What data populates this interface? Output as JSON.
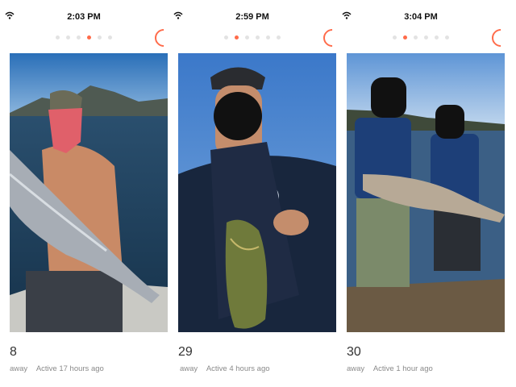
{
  "profiles": [
    {
      "time": "2:03 PM",
      "active_dot": 3,
      "dot_count": 6,
      "age": "8",
      "distance_suffix": "away",
      "activity": "Active 17 hours ago",
      "photo": "man-on-boat-holding-salmon"
    },
    {
      "time": "2:59 PM",
      "active_dot": 1,
      "dot_count": 6,
      "age": "29",
      "distance_suffix": "away",
      "activity": "Active 4 hours ago",
      "photo": "man-in-navy-tshirt-holding-bass"
    },
    {
      "time": "3:04 PM",
      "active_dot": 1,
      "dot_count": 6,
      "age": "30",
      "distance_suffix": "away",
      "activity": "Active 1 hour ago",
      "photo": "two-men-in-life-vests-holding-fish"
    }
  ],
  "colors": {
    "accent": "#ff6b4a",
    "dot_inactive": "#e3e3e3",
    "meta_text": "#8a8a8a",
    "age_text": "#333333"
  },
  "icons": [
    "wifi-icon",
    "refresh-spinner-icon"
  ]
}
